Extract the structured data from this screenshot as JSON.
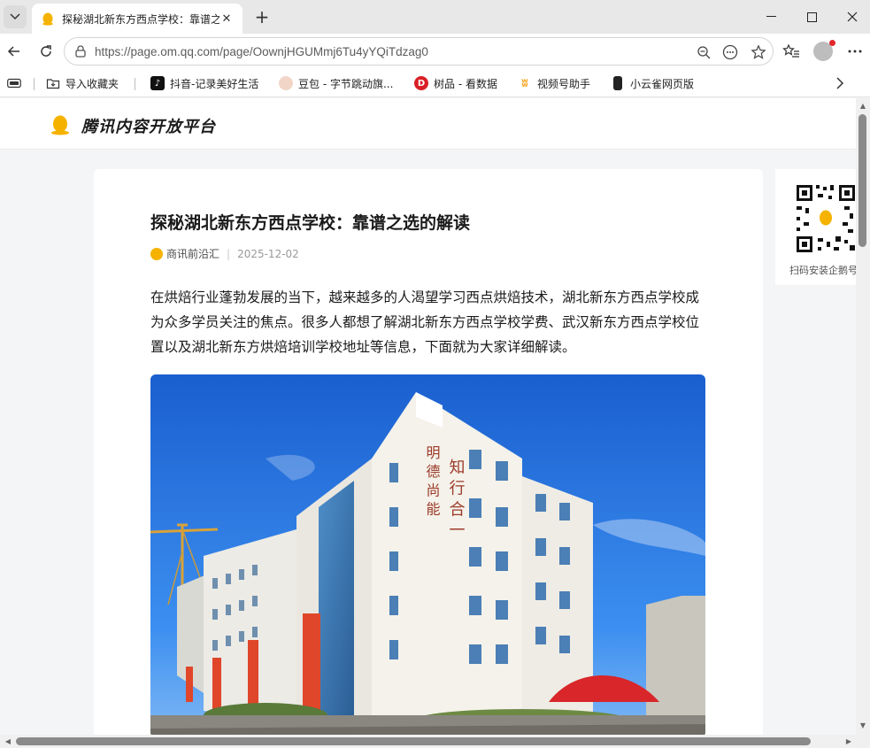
{
  "browser": {
    "tab_title": "探秘湖北新东方西点学校：靠谱之选的解读",
    "url": "https://page.om.qq.com/page/OownjHGUMmj6Tu4yYQiTdzag0",
    "bookmarks": [
      {
        "label": "导入收藏夹",
        "icon": "folder-import-icon"
      },
      {
        "label": "抖音-记录美好生活",
        "icon": "douyin-icon"
      },
      {
        "label": "豆包 - 字节跳动旗...",
        "icon": "doubao-icon"
      },
      {
        "label": "树品 - 看数据",
        "icon": "shupin-icon"
      },
      {
        "label": "视频号助手",
        "icon": "shipinhao-icon"
      },
      {
        "label": "小云雀网页版",
        "icon": "xiaoyunque-icon"
      }
    ]
  },
  "site": {
    "name": "腾讯内容开放平台"
  },
  "article": {
    "title": "探秘湖北新东方西点学校：靠谱之选的解读",
    "source": "商讯前沿汇",
    "date": "2025-12-02",
    "paragraph": "在烘焙行业蓬勃发展的当下，越来越多的人渴望学习西点烘焙技术，湖北新东方西点学校成为众多学员关注的焦点。很多人都想了解湖北新东方西点学校学费、武汉新东方西点学校位置以及湖北新东方烘焙培训学校地址等信息，下面就为大家详细解读。",
    "building_sign_1": "明 德 尚 能",
    "building_sign_2": "知 行 合 一"
  },
  "sidebar": {
    "qr_label": "扫码安装企鹅号"
  },
  "colors": {
    "accent": "#f5b300",
    "sky": "#1f6fd8"
  }
}
